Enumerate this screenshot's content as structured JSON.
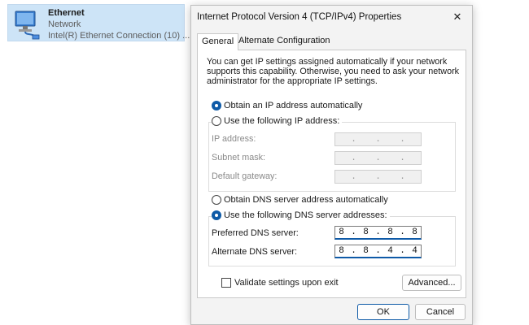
{
  "network_item": {
    "name": "Ethernet",
    "status": "Network",
    "adapter": "Intel(R) Ethernet Connection (10) ..."
  },
  "dialog": {
    "title": "Internet Protocol Version 4 (TCP/IPv4) Properties",
    "close_glyph": "✕",
    "tabs": [
      {
        "label": "General",
        "active": true
      },
      {
        "label": "Alternate Configuration",
        "active": false
      }
    ],
    "intro_text": "You can get IP settings assigned automatically if your network supports this capability. Otherwise, you need to ask your network administrator for the appropriate IP settings.",
    "ip": {
      "auto_label": "Obtain an IP address automatically",
      "auto_selected": true,
      "manual_label": "Use the following IP address:",
      "manual_selected": false,
      "ip_address_label": "IP address:",
      "subnet_label": "Subnet mask:",
      "gateway_label": "Default gateway:",
      "ip_address_value": [
        "",
        "",
        "",
        ""
      ],
      "subnet_value": [
        "",
        "",
        "",
        ""
      ],
      "gateway_value": [
        "",
        "",
        "",
        ""
      ]
    },
    "dns": {
      "auto_label": "Obtain DNS server address automatically",
      "auto_selected": false,
      "manual_label": "Use the following DNS server addresses:",
      "manual_selected": true,
      "preferred_label": "Preferred DNS server:",
      "alternate_label": "Alternate DNS server:",
      "preferred_value": [
        "8",
        "8",
        "8",
        "8"
      ],
      "alternate_value": [
        "8",
        "8",
        "4",
        "4"
      ]
    },
    "validate_label": "Validate settings upon exit",
    "validate_checked": false,
    "advanced_label": "Advanced...",
    "ok_label": "OK",
    "cancel_label": "Cancel"
  },
  "colors": {
    "selection_bg": "#cde4f7",
    "accent": "#0e5aa7",
    "dialog_bg": "#f3f3f3"
  }
}
